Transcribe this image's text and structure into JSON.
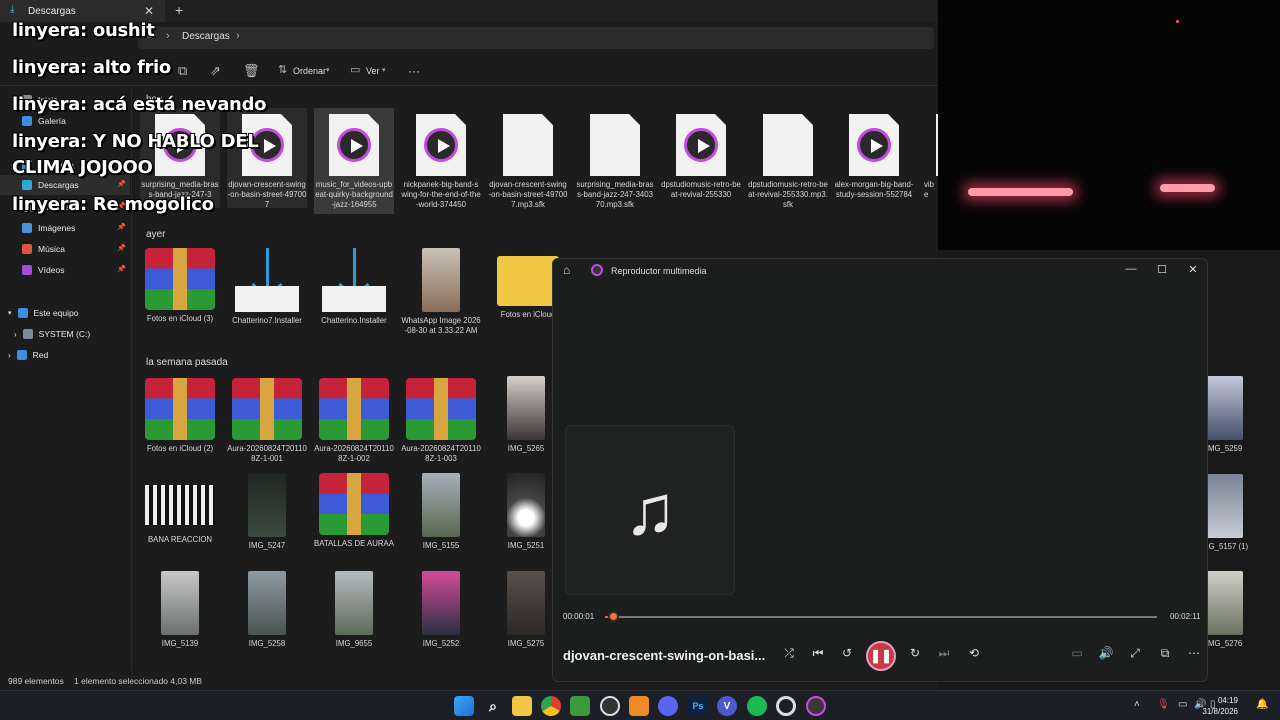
{
  "explorer": {
    "tab_title": "Descargas",
    "path": "Descargas",
    "toolbar": {
      "sort_label": "Ordenar",
      "view_label": "Ver",
      "more": "···"
    },
    "sidebar": [
      {
        "label": "Inicio"
      },
      {
        "label": "Galería"
      },
      {
        "label": "OneDrive"
      },
      {
        "label": "Descargas"
      },
      {
        "label": "Documentos"
      },
      {
        "label": "Imágenes"
      },
      {
        "label": "Música"
      },
      {
        "label": "Vídeos"
      },
      {
        "label": "Este equipo"
      },
      {
        "label": "SYSTEM (C:)"
      },
      {
        "label": "Red"
      }
    ],
    "groups": {
      "today": "hoy",
      "yesterday": "ayer",
      "last_week": "la semana pasada"
    },
    "today_files": [
      "surprising_media-brass-band-jazz-247-3",
      "djovan-crescent-swing-on-basin-street-497007",
      "music_for_videos-upbeat-quirky-background-jazz-164955",
      "nickpanek-big-band-swing-for-the-end-of-the-world-374450",
      "djovan-crescent-swing-on-basin-street-497007.mp3.sfk",
      "surprising_media-brass-band-jazz-247-340370.mp3.sfk",
      "dpstudiomusic-retro-beat-revival-255330",
      "dpstudiomusic-retro-beat-revival-255330.mp3.sfk",
      "alex-morgan-big-band-study-session-552784",
      "vibe"
    ],
    "yesterday_files": [
      "Fotos en iCloud (3)",
      "Chatterino7.Installer",
      "Chatterino.Installer",
      "WhatsApp Image 2026-08-30 at 3.33.22 AM",
      "Fotos en iCloud"
    ],
    "week_row1": [
      "Fotos en iCloud (2)",
      "Aura-20260824T201108Z-1-001",
      "Aura-20260824T201108Z-1-002",
      "Aura-20260824T201108Z-1-003",
      "IMG_5265"
    ],
    "week_row2": [
      "BANA REACCION",
      "IMG_5247",
      "BATALLAS DE AURAA",
      "IMG_5155",
      "IMG_5251"
    ],
    "week_row3": [
      "IMG_5139",
      "IMG_5258",
      "IMG_9655",
      "IMG_5252",
      "IMG_5275"
    ],
    "right_files": [
      "IMG_5259",
      "IMG_5157 (1)",
      "IMG_5276"
    ],
    "status": {
      "count": "989 elementos",
      "selected": "1 elemento seleccionado  4,03 MB"
    }
  },
  "chat": [
    "linyera: oushit",
    "linyera: alto frio",
    "linyera: acá está nevando",
    "linyera: Y NO HABLO DEL",
    "CLIMA JOJOOO",
    "linyera: Re mogolico"
  ],
  "player": {
    "app_title": "Reproductor multimedia",
    "song_title": "djovan-crescent-swing-on-basi...",
    "elapsed": "00:00:01",
    "duration": "00:02:11",
    "progress": 0.009
  },
  "taskbar": {
    "time": "04:19",
    "date": "31/8/2026"
  },
  "colors": {
    "accent": "#c34be0",
    "player_accent": "#e06a3a"
  }
}
